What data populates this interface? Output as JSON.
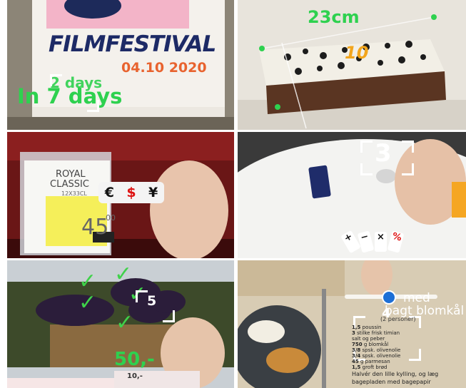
{
  "panels": {
    "festival": {
      "poster_title": "FILMFESTIVAL",
      "poster_date": "04.10 2020",
      "overlay_label": "In 7 days",
      "overlay_number": "2 days"
    },
    "cake": {
      "measure_label": "23cm",
      "cake_number": "10"
    },
    "price": {
      "tag_brand": "ROYAL",
      "tag_product": "CLASSIC",
      "tag_pack": "12X33CL",
      "tag_price": "45",
      "tag_price_cents": "00",
      "currency_euro": "€",
      "currency_dollar": "$",
      "currency_yen": "¥"
    },
    "table": {
      "count_label": "3",
      "operators": [
        "+",
        "−",
        "×",
        "%"
      ]
    },
    "eggplant": {
      "count_label": "5",
      "price_label": "50,-",
      "shelf_price": "10,-"
    },
    "recipe": {
      "heading_fragment": "med",
      "heading_fragment2": "bagt blomkål",
      "servings": "(2 personer)",
      "slider_value": "4",
      "ingredients": [
        {
          "qty": "1,5",
          "name": "poussin"
        },
        {
          "qty": "3",
          "name": "stilke frisk timian"
        },
        {
          "qty": "",
          "name": "salt og peber"
        },
        {
          "qty": "750",
          "name": "g blomkål"
        },
        {
          "qty": "3/8",
          "name": "spsk. olivenolie"
        },
        {
          "qty": "3/4",
          "name": "spsk. olivenolie"
        },
        {
          "qty": "45",
          "name": "g parmesan"
        },
        {
          "qty": "1,5",
          "name": "groft brød"
        }
      ],
      "instructions_line1": "Halvér den lille kylling, og læg",
      "instructions_line2": "bagepladen med bagepapir"
    }
  }
}
